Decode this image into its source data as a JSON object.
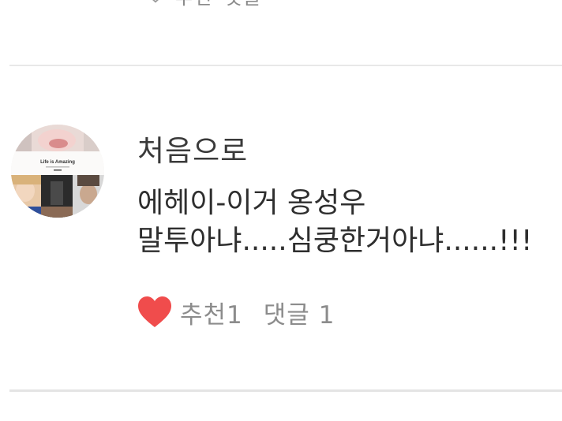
{
  "previous_comment": {
    "like_label": "추천",
    "reply_label": "댓글"
  },
  "comment": {
    "author": "처음으로",
    "body_lines": [
      "에헤이-이거 옹성우",
      "말투아냐.....심쿵한거아냐......!!!"
    ],
    "avatar_caption": "Life is Amazing",
    "like_label": "추천",
    "like_count": "1",
    "reply_label": "댓글",
    "reply_count": "1"
  },
  "colors": {
    "heart": "#f04c4c",
    "action_text": "#8c8c8c",
    "divider": "#e8e8e8"
  },
  "icons": {
    "like": "heart-icon"
  }
}
